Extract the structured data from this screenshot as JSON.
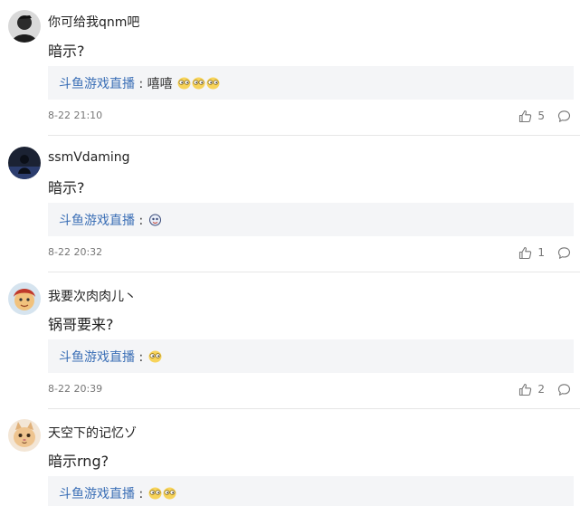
{
  "comments": [
    {
      "username": "你可给我qnm吧",
      "content": "暗示?",
      "reply": {
        "author": "斗鱼游戏直播",
        "colon": " : ",
        "text": "嘻嘻",
        "emojis": [
          "smirk-emoji",
          "smirk-emoji",
          "smirk-emoji"
        ]
      },
      "time": "8-22 21:10",
      "likes": "5",
      "avatar": "dark-figure-avatar"
    },
    {
      "username": "ssmVdaming",
      "content": "暗示?",
      "reply": {
        "author": "斗鱼游戏直播",
        "colon": " : ",
        "text": "",
        "emojis": [
          "sticker-emoji"
        ]
      },
      "time": "8-22 20:32",
      "likes": "1",
      "avatar": "night-silhouette-avatar"
    },
    {
      "username": "我要次肉肉儿丶",
      "content": "锅哥要来?",
      "reply": {
        "author": "斗鱼游戏直播",
        "colon": " : ",
        "text": "",
        "emojis": [
          "smirk-emoji"
        ]
      },
      "time": "8-22 20:39",
      "likes": "2",
      "avatar": "cartoon-avatar"
    },
    {
      "username": "天空下的记忆ゾ",
      "content": "暗示rng?",
      "reply": {
        "author": "斗鱼游戏直播",
        "colon": " : ",
        "text": "",
        "emojis": [
          "smirk-emoji",
          "smirk-emoji"
        ]
      },
      "time": "",
      "likes": "",
      "avatar": "cat-avatar"
    }
  ],
  "colors": {
    "reply_author": "#3b6fb6",
    "reply_bg": "#f4f5f7",
    "meta_text": "#777777",
    "divider": "#e6e6e6"
  }
}
